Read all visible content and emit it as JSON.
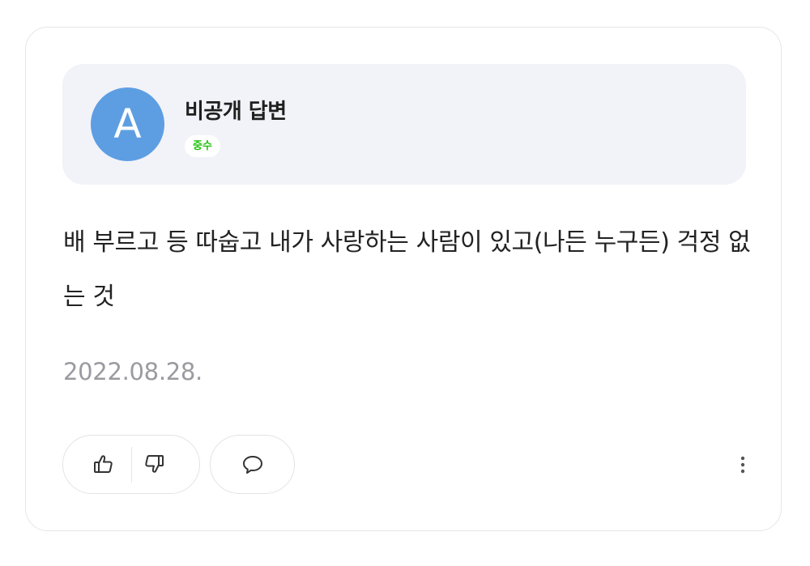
{
  "author": {
    "avatar_letter": "A",
    "name": "비공개 답변",
    "grade": "중수",
    "avatar_color": "#5d9ee3",
    "grade_color": "#20c20e"
  },
  "answer": {
    "text": "배 부르고 등 따숩고 내가 사랑하는 사람이 있고(나든 누구든) 걱정 없는 것",
    "date": "2022.08.28."
  },
  "actions": {
    "like_icon": "thumbs-up-icon",
    "dislike_icon": "thumbs-down-icon",
    "comment_icon": "speech-bubble-icon",
    "more_icon": "vertical-ellipsis-icon"
  }
}
